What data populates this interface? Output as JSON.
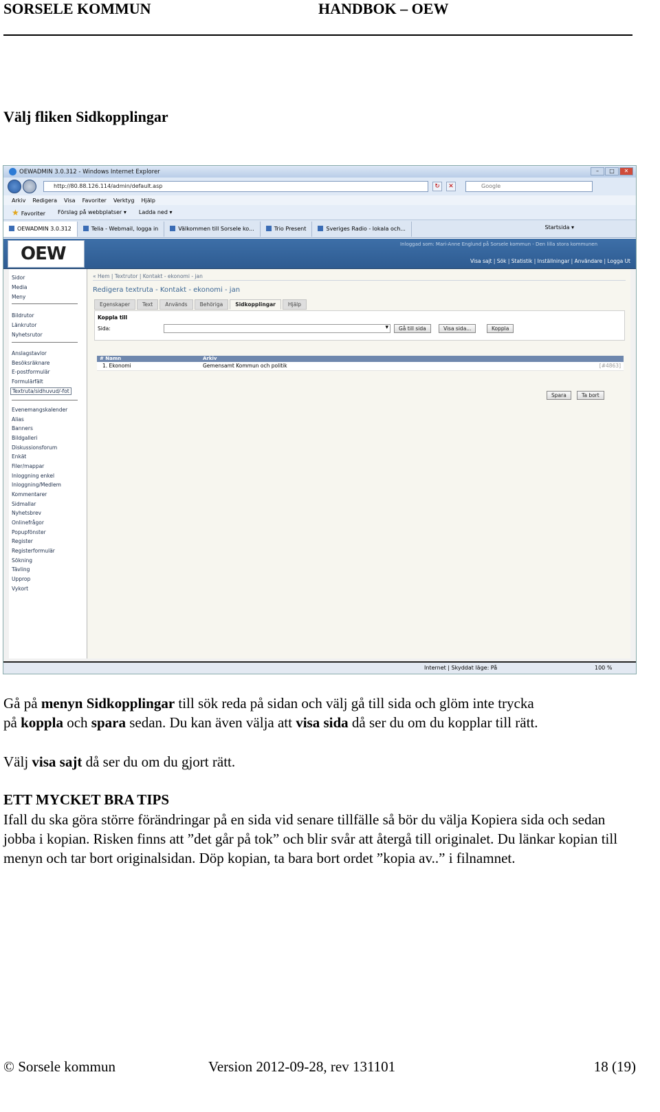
{
  "header": {
    "left": "SORSELE KOMMUN",
    "right": "HANDBOK – OEW"
  },
  "section_title": "Välj fliken Sidkopplingar",
  "screenshot": {
    "window_title": "OEWADMIN 3.0.312 - Windows Internet Explorer",
    "address": "http://80.88.126.114/admin/default.asp",
    "search_placeholder": "Google",
    "menu": [
      "Arkiv",
      "Redigera",
      "Visa",
      "Favoriter",
      "Verktyg",
      "Hjälp"
    ],
    "favorites": {
      "label": "Favoriter",
      "suggested": "Förslag på webbplatser ▾",
      "download": "Ladda ned ▾"
    },
    "tabs": [
      "OEWADMIN 3.0.312",
      "Telia - Webmail, logga in",
      "Välkommen till Sorsele ko...",
      "Trio Present",
      "Sveriges Radio - lokala och..."
    ],
    "home_label": "Startsida ▾",
    "app": {
      "logo": "OEW",
      "logged_in": "Inloggad som: Mari-Anne Englund på Sorsele kommun - Den lilla stora kommunen",
      "topnav": "Visa sajt | Sök | Statistik | Inställningar | Användare | Logga Ut",
      "sidebar_groups": [
        [
          "Sidor",
          "Media",
          "Meny"
        ],
        [
          "Bildrutor",
          "Länkrutor",
          "Nyhetsrutor"
        ],
        [
          "Anslagstavlor",
          "Besöksräknare",
          "E-postformulär",
          "Formulärfält",
          "Textruta/sidhuvud/-fot"
        ],
        [
          "Evenemangskalender",
          "Alias",
          "Banners",
          "Bildgalleri",
          "Diskussionsforum",
          "Enkät",
          "Filer/mappar",
          "Inloggning enkel",
          "Inloggning/Medlem",
          "Kommentarer",
          "Sidmallar",
          "Nyhetsbrev",
          "Onlinefrågor",
          "Popupfönster",
          "Register",
          "Registerformulär",
          "Sökning",
          "Tävling",
          "Upprop",
          "Vykort"
        ]
      ],
      "breadcrumb": "« Hem | Textrutor | Kontakt - ekonomi - jan",
      "page_heading": "Redigera textruta - Kontakt - ekonomi - jan",
      "tabs": [
        "Egenskaper",
        "Text",
        "Används",
        "Behöriga",
        "Sidkopplingar",
        "Hjälp"
      ],
      "panel": {
        "title": "Koppla till",
        "field_label": "Sida:",
        "btn_goto": "Gå till sida",
        "btn_show": "Visa sida...",
        "btn_link": "Koppla"
      },
      "table": {
        "col_num": "# Namn",
        "col_archive": "Arkiv",
        "row_name": "1. Ekonomi",
        "row_archive": "Gemensamt Kommun och politik",
        "row_id": "[#4863]"
      },
      "btn_save": "Spara",
      "btn_delete": "Ta bort"
    },
    "status": {
      "zone": "Internet | Skyddat läge: På",
      "zoom": "100 %"
    }
  },
  "para1": {
    "t1": "Gå på ",
    "b1": "menyn Sidkopplingar",
    "t2": " till sök reda på sidan och välj gå till sida och glöm inte trycka",
    "t3": "på ",
    "b2": "koppla",
    "t4": " och ",
    "b3": "spara",
    "t5": " sedan. Du kan även välja att ",
    "b4": "visa sida",
    "t6": " då ser du om du kopplar till rätt."
  },
  "para2": {
    "t1": "Välj ",
    "b1": "visa sajt",
    "t2": " då ser du om du gjort rätt."
  },
  "tips": {
    "title": "ETT MYCKET BRA TIPS",
    "body": "Ifall du ska göra större förändringar på en sida vid senare tillfälle så bör du välja Kopiera sida och sedan jobba i kopian. Risken finns att ”det går på tok” och blir svår att återgå till originalet. Du länkar kopian till menyn och tar bort originalsidan. Döp kopian, ta bara bort ordet ”kopia av..” i filnamnet."
  },
  "footer": {
    "left": "© Sorsele kommun",
    "center": "Version 2012-09-28, rev 131101",
    "right": "18  (19)"
  }
}
